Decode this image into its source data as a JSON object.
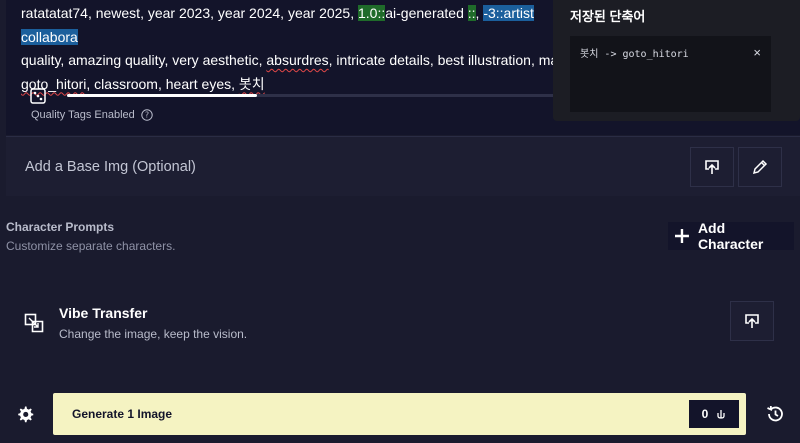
{
  "prompt": {
    "seg1": "ratatatat74, newest, year 2023, year 2024, year 2025, ",
    "seg2_green": "1.0::",
    "seg3": "ai-generated ",
    "seg4_green": "::",
    "seg5": ", ",
    "seg6_blue": "-3::artist collabora",
    "line2": "quality, amazing quality, very aesthetic, ",
    "line2_squiggle": "absurdres",
    "line2_rest": ", intricate details, best illustration, mast",
    "line3_squiggle": "goto_hitori",
    "line3_rest": ", classroom, heart eyes, ",
    "line3_korean": "봇치"
  },
  "slider": {
    "fill_fraction": 0.38
  },
  "quality_tags": {
    "label": "Quality Tags Enabled"
  },
  "shortcuts": {
    "title": "저장된 단축어",
    "entries": [
      {
        "text": "봇치 -> goto_hitori",
        "close": "×"
      }
    ]
  },
  "base_image": {
    "label": "Add a Base Img (Optional)"
  },
  "character_prompts": {
    "title": "Character Prompts",
    "subtitle": "Customize separate characters.",
    "add_label": "Add Character"
  },
  "vibe_transfer": {
    "title": "Vibe Transfer",
    "subtitle": "Change the image, keep the vision."
  },
  "generate": {
    "label": "Generate 1 Image",
    "cost": "0"
  },
  "colors": {
    "accent": "#f5f3c2",
    "background": "#1a1b2e",
    "panel": "#13142a",
    "highlight_green": "#1f6b2a",
    "highlight_blue": "#1b5f9c"
  }
}
